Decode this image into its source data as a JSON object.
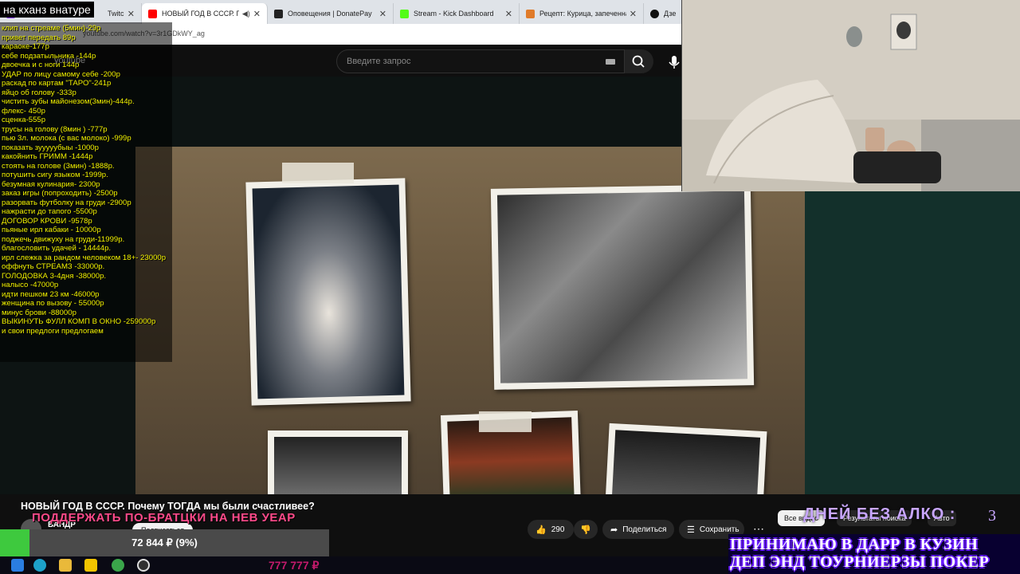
{
  "browser": {
    "tabs": [
      {
        "label": "Twitch",
        "active": false
      },
      {
        "label": "НОВЫЙ ГОД В СССР. Поче",
        "active": true
      },
      {
        "label": "Оповещения | DonatePay",
        "active": false
      },
      {
        "label": "Stream - Kick Dashboard",
        "active": false
      },
      {
        "label": "Рецепт: Курица, запеченная в",
        "active": false
      },
      {
        "label": "Дзе",
        "active": false
      }
    ],
    "url": "youtube.com/watch?v=3r1GDkWY_ag"
  },
  "youtube": {
    "logo": "youtube",
    "search_placeholder": "Введите запрос",
    "video_title": "НОВЫЙ ГОД В СССР. Почему ТОГДА мы были счастливее?",
    "channel_name": "ВАНДР",
    "subscribe_label": "Подписаться",
    "likes": "290",
    "share_label": "Поделиться",
    "save_label": "Сохранить",
    "chips": [
      "Все видео",
      "Результаты поиска",
      "Авто"
    ]
  },
  "stream": {
    "title": "на кханз внатуре",
    "price_list": [
      "клип на стреаме (5мин)-29р",
      "привет передать 89р",
      "караоке-177р",
      "себе подзатыльника -144р",
      "двоечка и с ноги 144р",
      "УДАР по лицу самому себе -200р",
      "раскад по картам \"ТАРО\"-241р",
      "яйцо об голову -333р",
      "чистить зубы майонезом(3мин)-444р.",
      "флекс- 450р",
      "сценка-555р",
      "трусы на голову (8мин ) -777р",
      "пью 3л. молока (с вас молоко) -999р",
      "показать зууууубыы -1000р",
      "какойнить ГРИММ -1444р",
      "стоять на голове (3мин) -1888р.",
      "потушить сигу языком -1999р.",
      "безумная кулинария- 2300р",
      "заказ игры (попроходить) -2500р",
      "разорвать футболку на груди -2900р",
      "нажрасти до тапого -5500р",
      "ДОГОВОР КРОВИ -9578р",
      "пьяные ирл кабаки - 10000р",
      "поджечь движуху на груди-11999р.",
      "благословить удачей - 14444р.",
      "ирл слежка за рандом человеком 18+- 23000р",
      "оффнуть СТРЕАМЗ -33000р.",
      "ГОЛОДОВКА 3-4дня -38000р.",
      "налысо -47000р",
      "идти пешком 23 км -46000р",
      "женщина по вызову - 55000р",
      "минус брови -88000р",
      "ВЫКИНУТЬ ФУЛЛ КОМП В ОКНО -259000р",
      "и свои предлоги предлогаем"
    ],
    "goal_text": "ПОДДЕРЖАТЬ ПО-БРАТЦКИ НА НЕВ УЕАР",
    "goal_amount": "72 844 ₽ (9%)",
    "goal_percent": 9,
    "last_donation": "777 777 ₽",
    "days_label": "ДНЕЙ БЕЗ АЛКО :",
    "days_count": "3",
    "banner_line1": "ПРИНИМАЮ В ДАРР В КУЗИН",
    "banner_line2": "ДЕП ЭНД ТОУРНИЕРЗЫ ПОКЕР"
  },
  "colors": {
    "price_text": "#f2f200",
    "goal_text": "#ff4a8a",
    "progress_fill": "#3ec93e",
    "days_text": "#c8a6ff",
    "banner_glow": "#6a1cff"
  },
  "icons": {
    "search": "search-icon",
    "mic": "mic-icon",
    "like": "thumbs-up-icon",
    "dislike": "thumbs-down-icon",
    "share": "share-icon",
    "save": "save-icon"
  }
}
